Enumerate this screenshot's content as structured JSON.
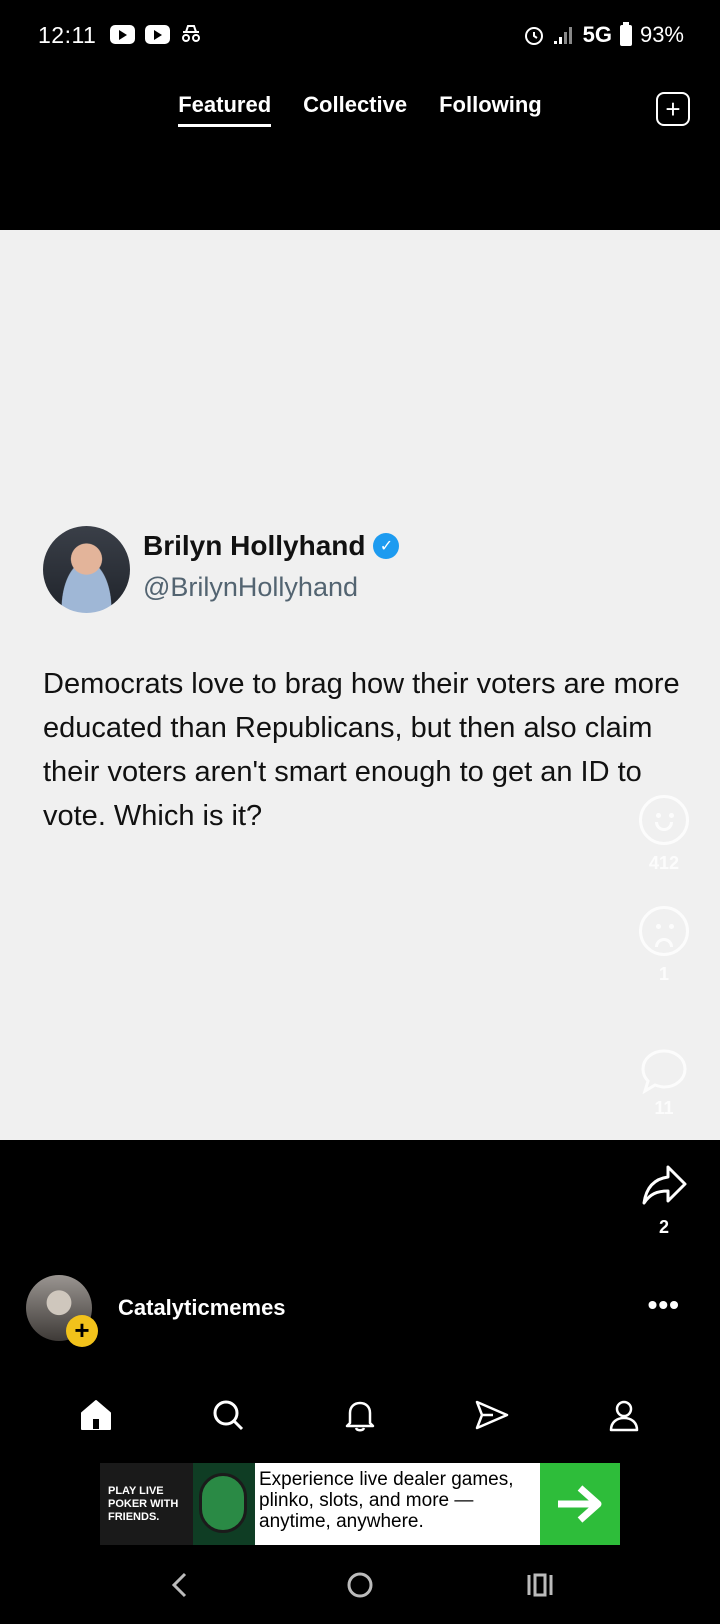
{
  "status_bar": {
    "time": "12:11",
    "network": "5G",
    "battery": "93%"
  },
  "tabs": [
    {
      "label": "Featured",
      "active": true
    },
    {
      "label": "Collective",
      "active": false
    },
    {
      "label": "Following",
      "active": false
    }
  ],
  "tweet": {
    "name": "Brilyn Hollyhand",
    "handle": "@BrilynHollyhand",
    "text": "Democrats love to brag how their voters are more educated than Republicans, but then also claim their voters aren't smart enough to get an ID to vote. Which is it?"
  },
  "reactions": {
    "happy_count": "412",
    "sad_count": "1",
    "comment_count": "11",
    "share_count": "2"
  },
  "post": {
    "username": "Catalyticmemes"
  },
  "ad": {
    "image_text": "PLAY LIVE POKER WITH FRIENDS.",
    "text": "Experience live dealer games, plinko, slots, and more — anytime, anywhere."
  },
  "colors": {
    "background": "#000000",
    "meme_background": "#f0f0f0",
    "verified": "#1d9bf0",
    "follow_badge": "#f2c21b",
    "ad_cta": "#2ebd3a"
  }
}
